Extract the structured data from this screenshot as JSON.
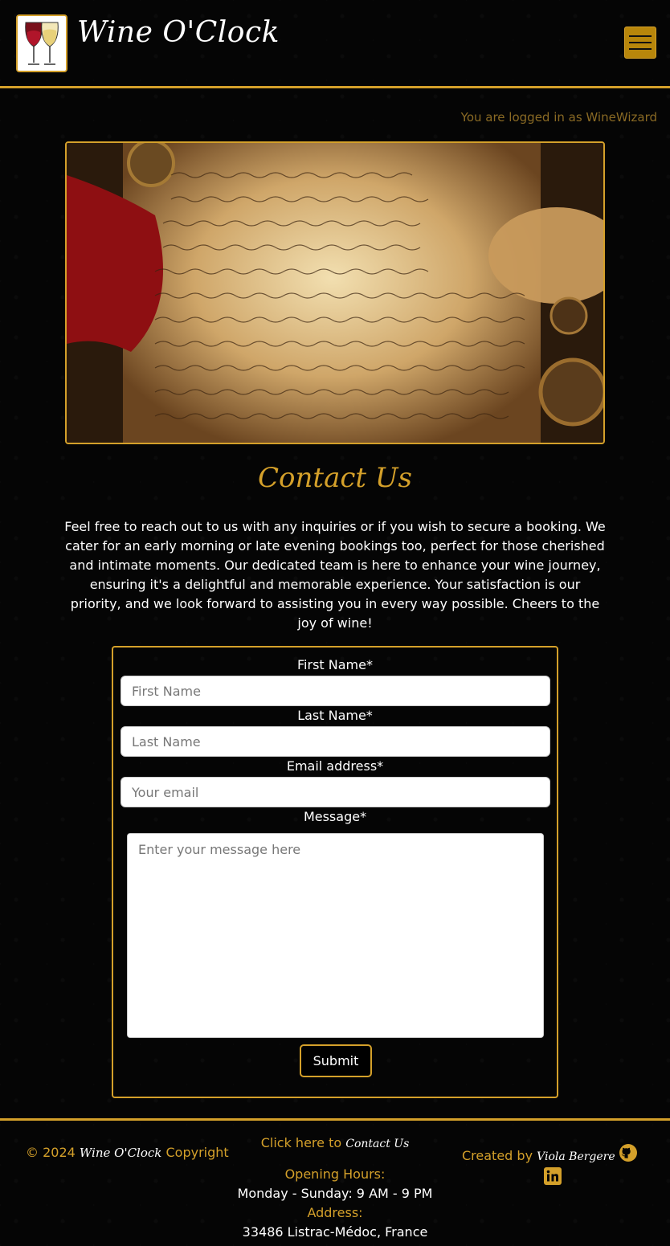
{
  "header": {
    "app_title": "Wine O'Clock",
    "logo_icon": "wine-glasses-icon",
    "menu_icon": "hamburger-menu-icon"
  },
  "status": {
    "logged_in_text": "You are logged in as WineWizard"
  },
  "hero": {
    "image_icon": "parchment-letter-image"
  },
  "page": {
    "title": "Contact Us",
    "intro": "Feel free to reach out to us with any inquiries or if you wish to secure a booking. We cater for an early morning or late evening bookings too, perfect for those cherished and intimate moments. Our dedicated team is here to enhance your wine journey, ensuring it's a delightful and memorable experience. Your satisfaction is our priority, and we look forward to assisting you in every way possible. Cheers to the joy of wine!"
  },
  "form": {
    "first_name_label": "First Name*",
    "first_name_placeholder": "First Name",
    "first_name_value": "",
    "last_name_label": "Last Name*",
    "last_name_placeholder": "Last Name",
    "last_name_value": "",
    "email_label": "Email address*",
    "email_placeholder": "Your email",
    "email_value": "",
    "message_label": "Message*",
    "message_placeholder": "Enter your message here",
    "message_value": "",
    "submit_label": "Submit"
  },
  "footer": {
    "copyright_prefix": "© 2024",
    "copyright_brand": "Wine O'Clock",
    "copyright_suffix": "Copyright",
    "contact_link_prefix": "Click here to",
    "contact_link_script": "Contact Us",
    "opening_hours_label": "Opening Hours:",
    "opening_hours_value": "Monday - Sunday: 9 AM - 9 PM",
    "address_label": "Address:",
    "address_value": "33486 Listrac-Médoc, France",
    "created_prefix": "Created by",
    "created_name": "Viola Bergere",
    "github_icon": "github-icon",
    "linkedin_icon": "linkedin-icon"
  },
  "colors": {
    "accent": "#d4a02a",
    "background": "#050505",
    "muted_accent": "#8a6a24"
  }
}
